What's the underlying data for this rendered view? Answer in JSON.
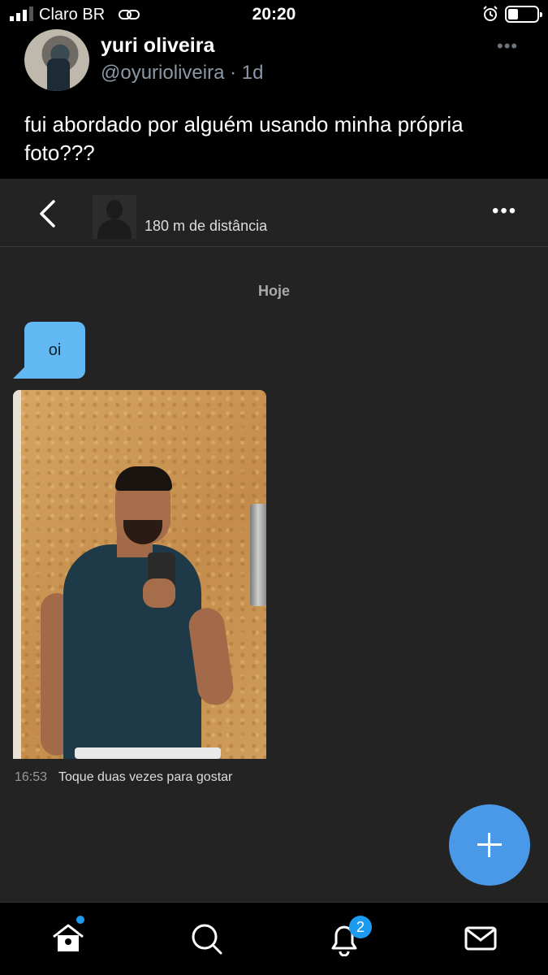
{
  "status_bar": {
    "carrier": "Claro BR",
    "time": "20:20",
    "icons": [
      "signal-icon",
      "link-icon",
      "alarm-icon",
      "battery-icon"
    ]
  },
  "tweet": {
    "author_name": "yuri oliveira",
    "handle": "@oyurioliveira",
    "separator": " · ",
    "age": "1d",
    "more_label": "•••",
    "text": "fui abordado por alguém usando minha própria foto???"
  },
  "chat": {
    "back_icon": "chevron-left-icon",
    "distance": "180 m de distância",
    "more_label": "•••",
    "date_separator": "Hoje",
    "message_text": "oi",
    "message_time": "16:53",
    "message_hint": "Toque duas vezes para gostar"
  },
  "fab": {
    "icon": "plus-icon"
  },
  "bottom_nav": {
    "items": [
      {
        "icon": "home-icon",
        "has_dot": true
      },
      {
        "icon": "search-icon"
      },
      {
        "icon": "bell-icon",
        "badge": "2"
      },
      {
        "icon": "mail-icon"
      }
    ]
  },
  "colors": {
    "accent": "#1d9bf0",
    "bubble": "#62b8f2",
    "chat_background": "#232323"
  }
}
